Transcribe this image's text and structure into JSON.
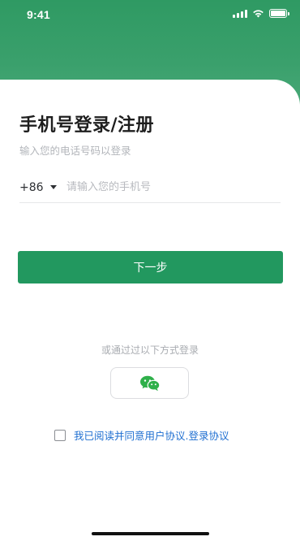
{
  "status_bar": {
    "time": "9:41"
  },
  "login": {
    "title": "手机号登录/注册",
    "subtitle": "输入您的电话号码以登录",
    "country_code": "+86",
    "phone_placeholder": "请输入您的手机号",
    "phone_value": "",
    "next_label": "下一步"
  },
  "alt_login": {
    "label": "或通过过以下方式登录",
    "wechat_icon": "wechat-icon"
  },
  "agreement": {
    "checked": false,
    "text": "我已阅读并同意用户协议.登录协议"
  },
  "colors": {
    "brand_green": "#22985f",
    "header_green": "#3aa06c",
    "link_blue": "#1f6fd1"
  }
}
